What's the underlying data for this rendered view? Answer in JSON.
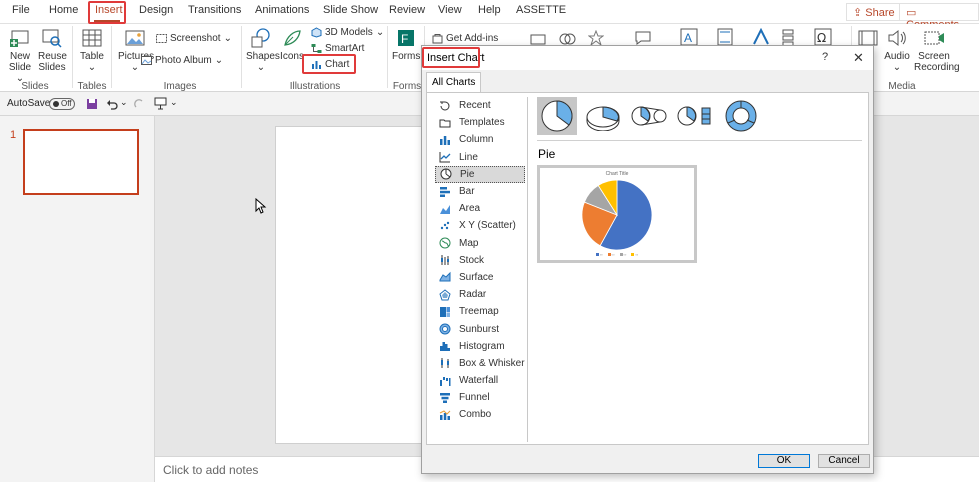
{
  "tabs": [
    "File",
    "Home",
    "Insert",
    "Design",
    "Transitions",
    "Animations",
    "Slide Show",
    "Review",
    "View",
    "Help",
    "ASSETTE"
  ],
  "share_label": "Share",
  "comments_label": "Comments",
  "ribbon": {
    "new_slide": [
      "New",
      "Slide"
    ],
    "reuse_slides": [
      "Reuse",
      "Slides"
    ],
    "table": "Table",
    "pictures": "Pictures",
    "screenshot": "Screenshot",
    "photo_album": "Photo Album",
    "shapes": "Shapes",
    "icons": "Icons",
    "models_3d": "3D Models",
    "smartart": "SmartArt",
    "chart": "Chart",
    "forms": "Forms",
    "get_addins": "Get Add-ins",
    "audio": "Audio",
    "screen_recording": [
      "Screen",
      "Recording"
    ],
    "groups": {
      "slides": "Slides",
      "tables": "Tables",
      "images": "Images",
      "illustrations": "Illustrations",
      "forms": "Forms",
      "media": "Media"
    }
  },
  "qat": {
    "autosave": "AutoSave",
    "toggle": "Off"
  },
  "thumbnail": {
    "number": "1"
  },
  "notes_placeholder": "Click to add notes",
  "dialog": {
    "title": "Insert Chart",
    "help": "?",
    "close": "✕",
    "tab": "All Charts",
    "categories": [
      "Recent",
      "Templates",
      "Column",
      "Line",
      "Pie",
      "Bar",
      "Area",
      "X Y (Scatter)",
      "Map",
      "Stock",
      "Surface",
      "Radar",
      "Treemap",
      "Sunburst",
      "Histogram",
      "Box & Whisker",
      "Waterfall",
      "Funnel",
      "Combo"
    ],
    "selected_category": "Pie",
    "type_name": "Pie",
    "preview_title": "Chart Title",
    "ok": "OK",
    "cancel": "Cancel"
  },
  "colors": {
    "accent": "#b7472a",
    "highlight": "#e03a3a",
    "pie_blue": "#4472c4",
    "pie_orange": "#ed7d31",
    "pie_gray": "#a5a5a5",
    "pie_yellow": "#ffc000"
  },
  "chart_data": {
    "type": "pie",
    "title": "Chart Title",
    "values": [
      58,
      23,
      10,
      9
    ]
  }
}
